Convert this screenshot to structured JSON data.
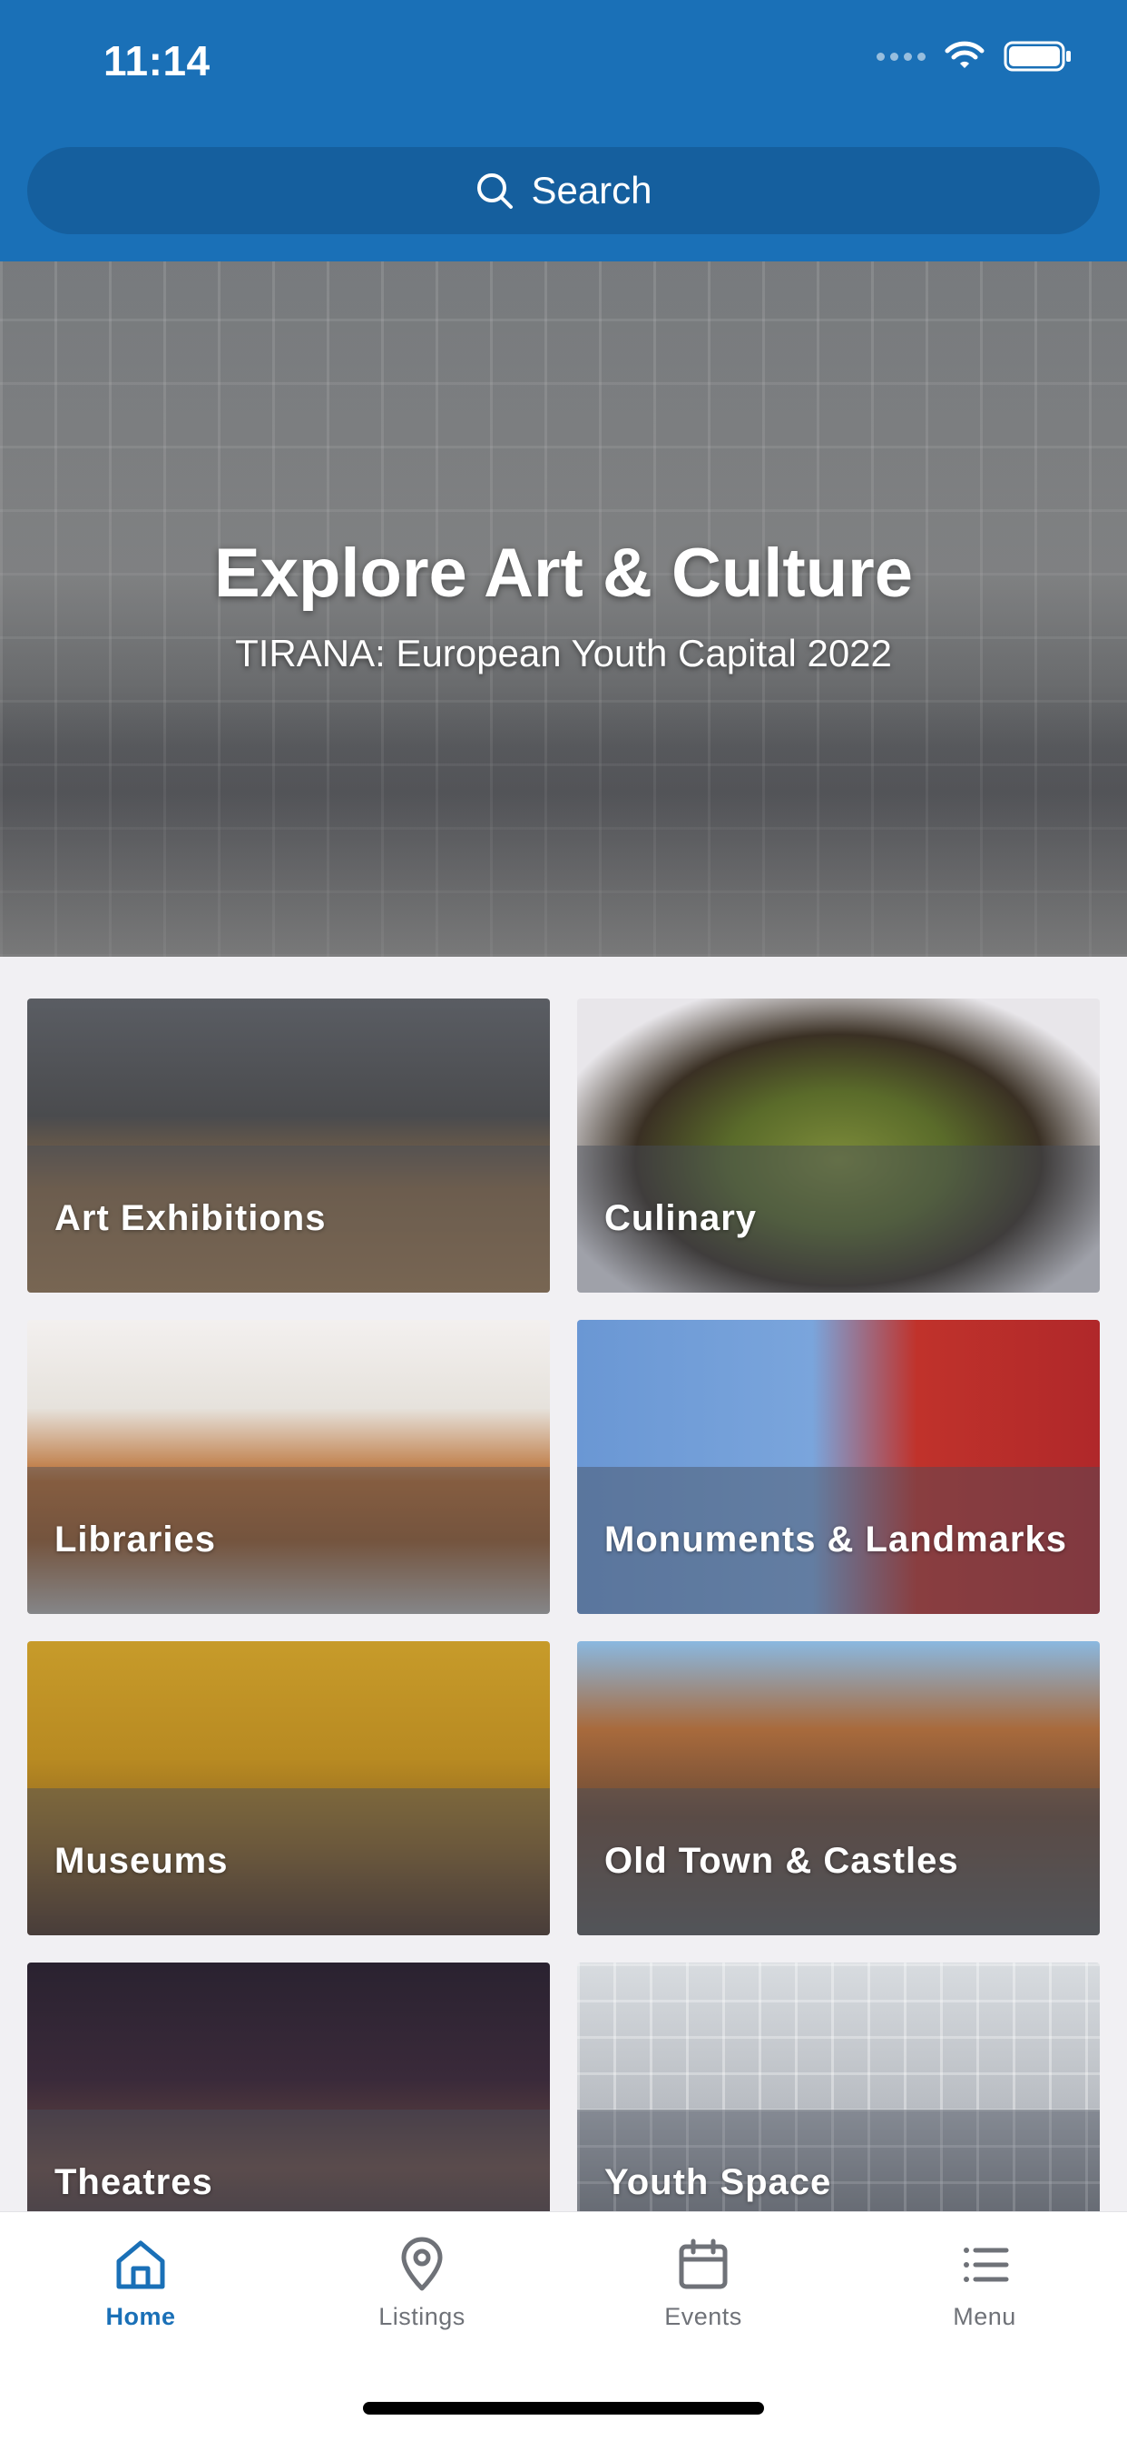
{
  "status_bar": {
    "time": "11:14"
  },
  "search": {
    "label": "Search"
  },
  "hero": {
    "title": "Explore Art & Culture",
    "subtitle": "TIRANA: European Youth Capital 2022"
  },
  "categories": [
    {
      "label": "Art Exhibitions"
    },
    {
      "label": "Culinary"
    },
    {
      "label": "Libraries"
    },
    {
      "label": "Monuments & Landmarks"
    },
    {
      "label": "Museums"
    },
    {
      "label": "Old Town & Castles"
    },
    {
      "label": "Theatres"
    },
    {
      "label": "Youth Space"
    }
  ],
  "tabs": [
    {
      "label": "Home",
      "icon": "home-icon",
      "active": true
    },
    {
      "label": "Listings",
      "icon": "location-pin-icon",
      "active": false
    },
    {
      "label": "Events",
      "icon": "calendar-icon",
      "active": false
    },
    {
      "label": "Menu",
      "icon": "list-menu-icon",
      "active": false
    }
  ],
  "colors": {
    "brand": "#1a70b7",
    "search_bg": "#155f9e",
    "background": "#f1f0f3",
    "tab_inactive": "#6f7278"
  }
}
